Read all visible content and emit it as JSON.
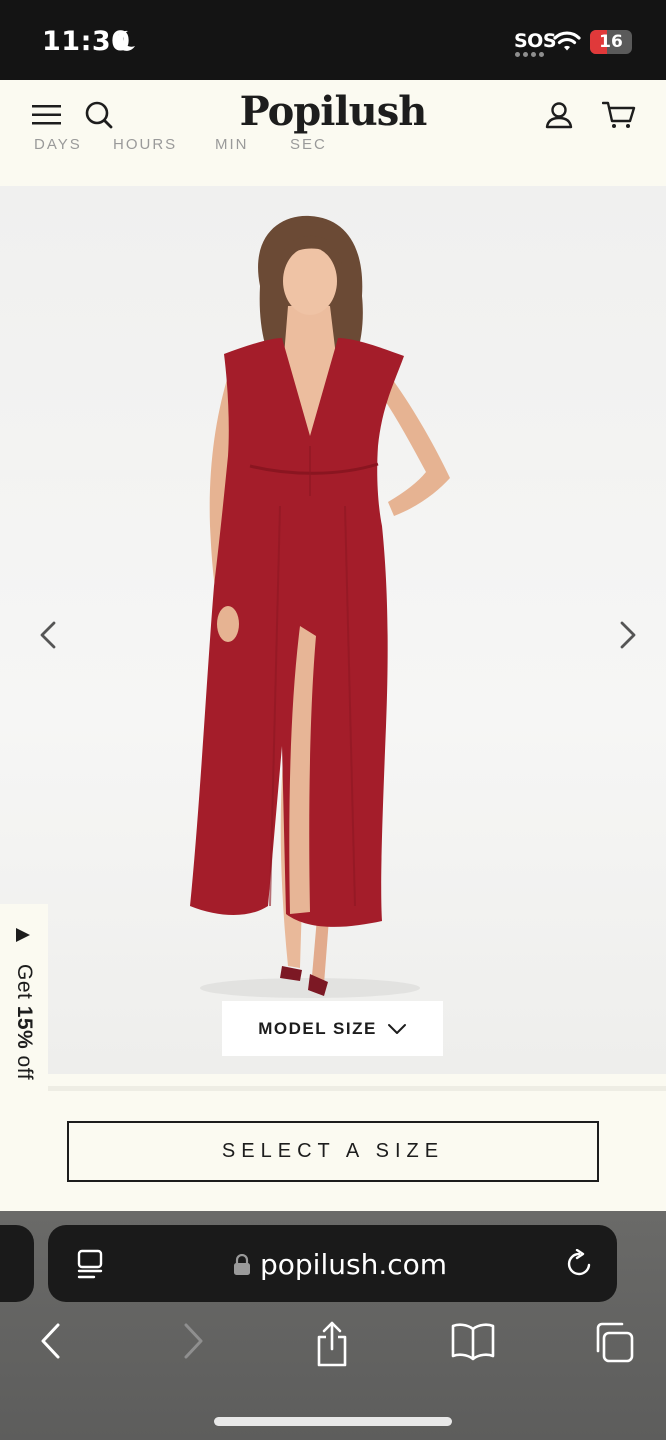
{
  "status_bar": {
    "time": "11:30",
    "moon_icon": "moon-icon",
    "sos": "SOS",
    "wifi_icon": "wifi-icon",
    "battery_level": "16",
    "battery_color": "#e0393a"
  },
  "header": {
    "logo": "Popilush",
    "menu_icon": "hamburger-menu-icon",
    "search_icon": "search-icon",
    "account_icon": "account-icon",
    "cart_icon": "cart-icon",
    "countdown_labels": [
      "DAYS",
      "HOURS",
      "MIN",
      "SEC"
    ]
  },
  "gallery": {
    "prev_icon": "chevron-left-icon",
    "next_icon": "chevron-right-icon",
    "model_size_label": "MODEL SIZE",
    "dress_color": "#a41d2a"
  },
  "promo": {
    "prefix": "Get ",
    "highlight": "15%",
    "suffix": " off"
  },
  "product": {
    "select_size_label": "SELECT A SIZE"
  },
  "browser": {
    "url": "popilush.com",
    "toolbar_icons": [
      "back-icon",
      "forward-icon",
      "share-icon",
      "bookmarks-icon",
      "tabs-icon"
    ]
  }
}
